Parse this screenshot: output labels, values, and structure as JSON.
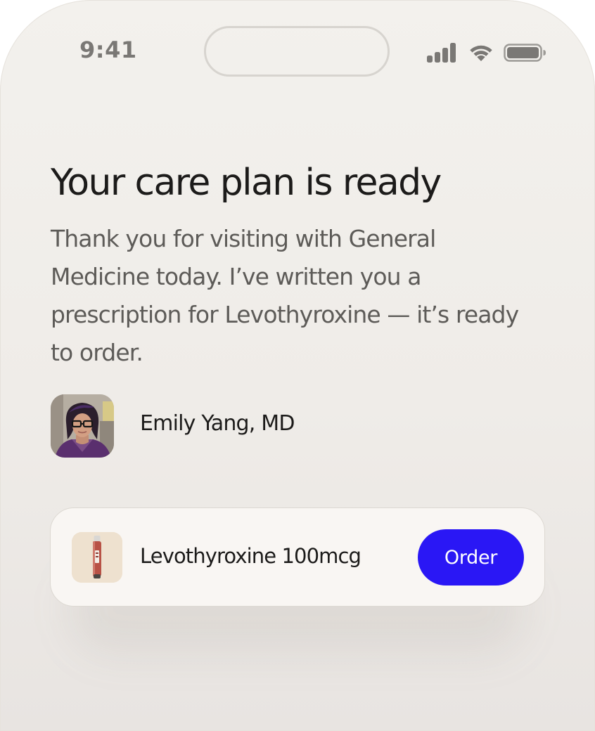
{
  "status_bar": {
    "time": "9:41",
    "icons": [
      "cellular-signal-icon",
      "wifi-icon",
      "battery-icon"
    ]
  },
  "care_plan": {
    "title": "Your care plan is ready",
    "message": "Thank you for visiting with General Medicine today. I’ve written you a prescription for Levothyroxine — it’s ready to order."
  },
  "doctor": {
    "name": "Emily Yang, MD"
  },
  "prescription": {
    "name": "Levothyroxine 100mcg",
    "order_label": "Order"
  },
  "colors": {
    "accent": "#2a17f5",
    "background": "#f1eeea",
    "card": "#f9f6f3",
    "text_primary": "#1c1b1a",
    "text_secondary": "#5d5b58"
  }
}
